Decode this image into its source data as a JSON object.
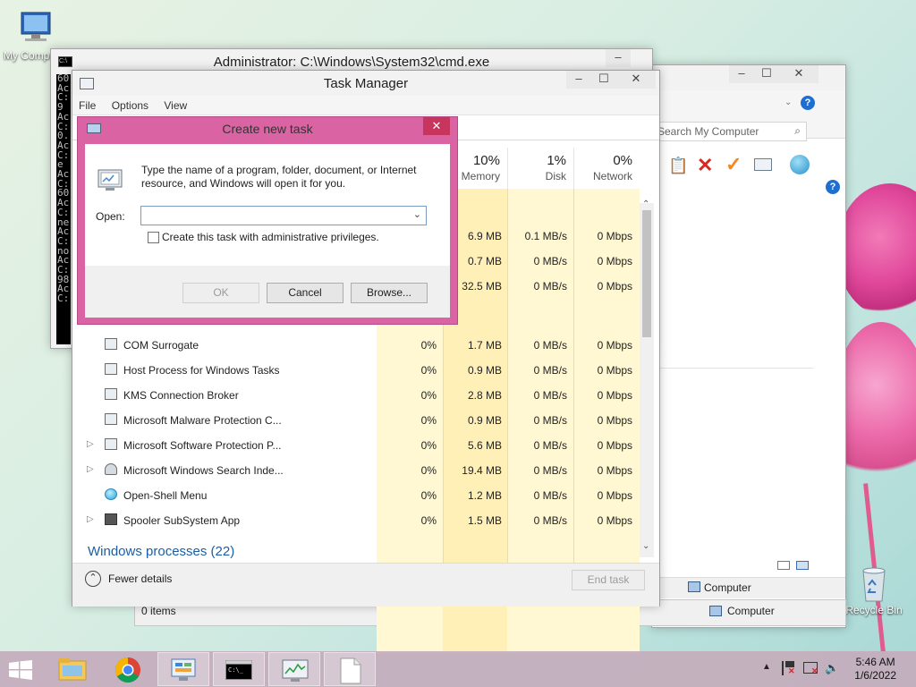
{
  "desktop": {
    "icons": [
      {
        "label": "My Computer",
        "icon": "computer-icon"
      },
      {
        "label": "Recycle Bin",
        "icon": "recycle-bin-icon"
      }
    ]
  },
  "cmd_window": {
    "title": "Administrator: C:\\Windows\\System32\\cmd.exe",
    "text": "60 Ac C:.9 Ac C:0.Ac C:e Ac C:60 Ac C:ne Ac C:no Ac C:98 Ac C:"
  },
  "explorer_window": {
    "search_placeholder": "Search My Computer",
    "status_items": "0 items",
    "computer_label_1": "Computer",
    "computer_label_2": "Computer"
  },
  "task_manager": {
    "title": "Task Manager",
    "menu": [
      "File",
      "Options",
      "View"
    ],
    "columns": [
      {
        "pct": "10%",
        "label": "Memory"
      },
      {
        "pct": "1%",
        "label": "Disk"
      },
      {
        "pct": "0%",
        "label": "Network"
      }
    ],
    "hidden_rows": [
      {
        "memory": "6.9 MB",
        "disk": "0.1 MB/s",
        "network": "0 Mbps"
      },
      {
        "memory": "0.7 MB",
        "disk": "0 MB/s",
        "network": "0 Mbps"
      },
      {
        "memory": "32.5 MB",
        "disk": "0 MB/s",
        "network": "0 Mbps"
      }
    ],
    "processes": [
      {
        "name": "COM Surrogate",
        "cpu": "0%",
        "memory": "1.7 MB",
        "disk": "0 MB/s",
        "network": "0 Mbps",
        "expandable": false
      },
      {
        "name": "Host Process for Windows Tasks",
        "cpu": "0%",
        "memory": "0.9 MB",
        "disk": "0 MB/s",
        "network": "0 Mbps",
        "expandable": false
      },
      {
        "name": "KMS Connection Broker",
        "cpu": "0%",
        "memory": "2.8 MB",
        "disk": "0 MB/s",
        "network": "0 Mbps",
        "expandable": false
      },
      {
        "name": "Microsoft Malware Protection C...",
        "cpu": "0%",
        "memory": "0.9 MB",
        "disk": "0 MB/s",
        "network": "0 Mbps",
        "expandable": false
      },
      {
        "name": "Microsoft Software Protection P...",
        "cpu": "0%",
        "memory": "5.6 MB",
        "disk": "0 MB/s",
        "network": "0 Mbps",
        "expandable": true
      },
      {
        "name": "Microsoft Windows Search Inde...",
        "cpu": "0%",
        "memory": "19.4 MB",
        "disk": "0 MB/s",
        "network": "0 Mbps",
        "expandable": true
      },
      {
        "name": "Open-Shell Menu",
        "cpu": "0%",
        "memory": "1.2 MB",
        "disk": "0 MB/s",
        "network": "0 Mbps",
        "expandable": false
      },
      {
        "name": "Spooler SubSystem App",
        "cpu": "0%",
        "memory": "1.5 MB",
        "disk": "0 MB/s",
        "network": "0 Mbps",
        "expandable": true
      }
    ],
    "section_title": "Windows processes (22)",
    "fewer_details": "Fewer details",
    "end_task": "End task"
  },
  "dialog": {
    "title": "Create new task",
    "description": "Type the name of a program, folder, document, or Internet resource, and Windows will open it for you.",
    "open_label": "Open:",
    "open_value": "",
    "admin_checkbox_label": "Create this task with administrative privileges.",
    "ok_label": "OK",
    "cancel_label": "Cancel",
    "browse_label": "Browse..."
  },
  "taskbar": {
    "time": "5:46 AM",
    "date": "1/6/2022"
  },
  "colors": {
    "dialog_frame": "#d963a3",
    "dialog_close": "#c7355d",
    "link_blue": "#1a5ea8",
    "heat_light": "#fff8d2",
    "heat_medium": "#fff0b8"
  }
}
